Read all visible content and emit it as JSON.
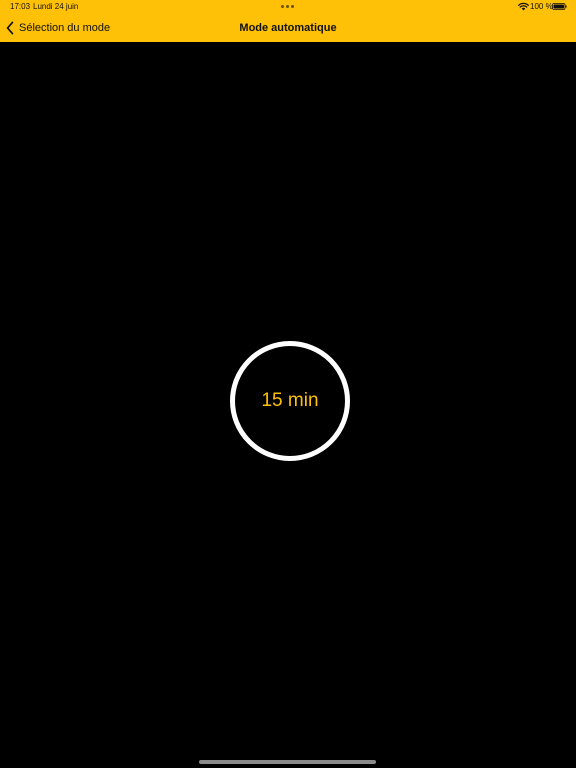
{
  "status_bar": {
    "time": "17:03",
    "date": "Lundi 24 juin",
    "battery": "100 %",
    "icons": [
      "wifi-icon",
      "battery-icon",
      "multitask-dots-icon"
    ]
  },
  "nav": {
    "back_label": "Sélection du mode",
    "title": "Mode automatique",
    "back_icon": "chevron-left-icon"
  },
  "timer": {
    "label": "15 min"
  },
  "colors": {
    "accent": "#FFC107",
    "background": "#000000",
    "ring": "#FFFFFF"
  }
}
